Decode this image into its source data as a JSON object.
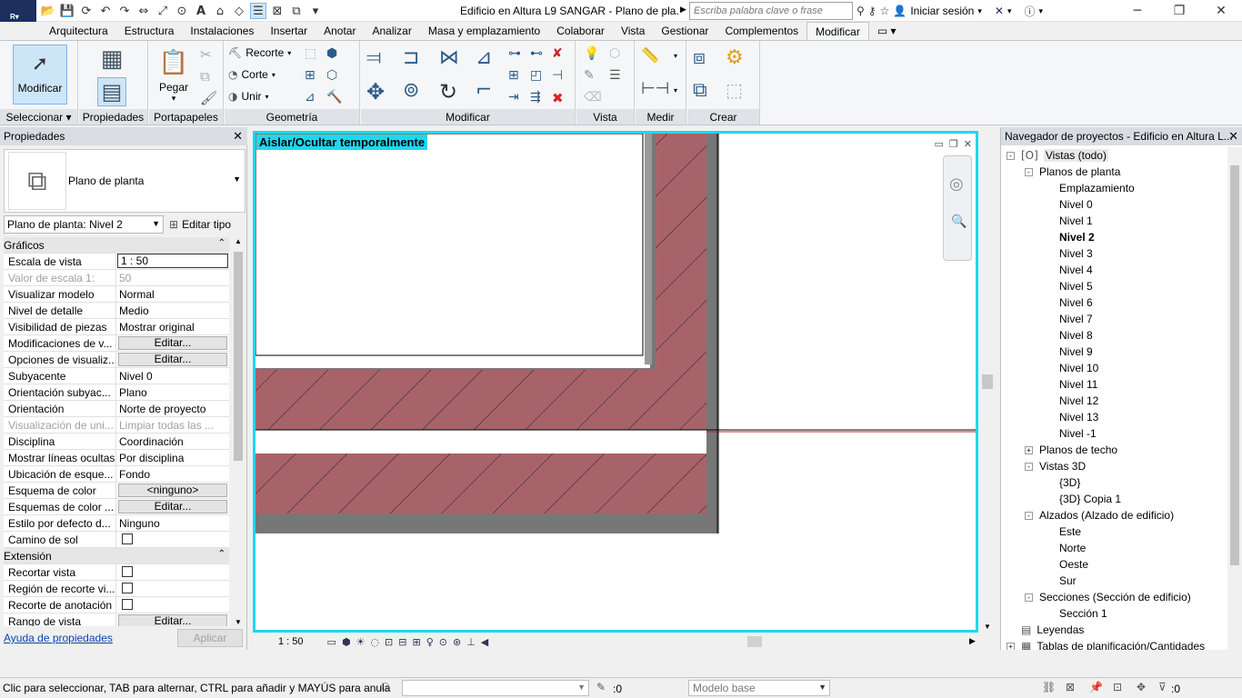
{
  "app": {
    "logo": "R",
    "window_title": "Edificio en Altura L9 SANGAR - Plano de pla...",
    "search_placeholder": "Escriba palabra clave o frase",
    "sign_in": "Iniciar sesión"
  },
  "tabs": [
    "Arquitectura",
    "Estructura",
    "Instalaciones",
    "Insertar",
    "Anotar",
    "Analizar",
    "Masa y emplazamiento",
    "Colaborar",
    "Vista",
    "Gestionar",
    "Complementos",
    "Modificar"
  ],
  "active_tab": "Modificar",
  "ribbon": {
    "panels": [
      "Seleccionar",
      "Propiedades",
      "Portapapeles",
      "Geometría",
      "Modificar",
      "Vista",
      "Medir",
      "Crear"
    ],
    "modify_btn": "Modificar",
    "paste_btn": "Pegar",
    "cut_btn": "Recorte",
    "trim_btn": "Corte",
    "join_btn": "Unir"
  },
  "properties": {
    "header": "Propiedades",
    "type_name": "Plano de planta",
    "instance": "Plano de planta: Nivel 2",
    "edit_type": "Editar tipo",
    "rows": [
      {
        "k": "Gráficos",
        "sec": true
      },
      {
        "k": "Escala de vista",
        "v": "1 : 50",
        "kind": "input"
      },
      {
        "k": "Valor de escala    1:",
        "v": "50",
        "dis": true
      },
      {
        "k": "Visualizar modelo",
        "v": "Normal"
      },
      {
        "k": "Nivel de detalle",
        "v": "Medio"
      },
      {
        "k": "Visibilidad de piezas",
        "v": "Mostrar original"
      },
      {
        "k": "Modificaciones de v...",
        "v": "Editar...",
        "kind": "btn"
      },
      {
        "k": "Opciones de visualiz...",
        "v": "Editar...",
        "kind": "btn"
      },
      {
        "k": "Subyacente",
        "v": "Nivel 0"
      },
      {
        "k": "Orientación subyac...",
        "v": "Plano"
      },
      {
        "k": "Orientación",
        "v": "Norte de proyecto"
      },
      {
        "k": "Visualización de uni...",
        "v": "Limpiar todas las ...",
        "dis": true
      },
      {
        "k": "Disciplina",
        "v": "Coordinación"
      },
      {
        "k": "Mostrar líneas ocultas",
        "v": "Por disciplina"
      },
      {
        "k": "Ubicación de esque...",
        "v": "Fondo"
      },
      {
        "k": "Esquema de color",
        "v": "<ninguno>",
        "kind": "btn"
      },
      {
        "k": "Esquemas de color ...",
        "v": "Editar...",
        "kind": "btn"
      },
      {
        "k": "Estilo por defecto d...",
        "v": "Ninguno"
      },
      {
        "k": "Camino de sol",
        "v": "",
        "kind": "cb"
      },
      {
        "k": "Extensión",
        "sec": true
      },
      {
        "k": "Recortar vista",
        "v": "",
        "kind": "cb"
      },
      {
        "k": "Región de recorte vi...",
        "v": "",
        "kind": "cb"
      },
      {
        "k": "Recorte de anotación",
        "v": "",
        "kind": "cb"
      },
      {
        "k": "Rango de vista",
        "v": "Editar...",
        "kind": "btn"
      }
    ],
    "help_link": "Ayuda de propiedades",
    "apply": "Aplicar"
  },
  "view": {
    "isolate_label": "Aislar/Ocultar temporalmente",
    "scale": "1 : 50",
    "wall_color": "#a8636a",
    "border_color": "#1fd7ef"
  },
  "browser": {
    "header": "Navegador de proyectos - Edificio en Altura L...",
    "nodes": [
      {
        "t": "Vistas (todo)",
        "lvl": 0,
        "tg": "-",
        "icon": "[O]",
        "sel": true
      },
      {
        "t": "Planos de planta",
        "lvl": 1,
        "tg": "-"
      },
      {
        "t": "Emplazamiento",
        "lvl": 2
      },
      {
        "t": "Nivel 0",
        "lvl": 2
      },
      {
        "t": "Nivel 1",
        "lvl": 2
      },
      {
        "t": "Nivel 2",
        "lvl": 2,
        "bold": true
      },
      {
        "t": "Nivel 3",
        "lvl": 2
      },
      {
        "t": "Nivel 4",
        "lvl": 2
      },
      {
        "t": "Nivel 5",
        "lvl": 2
      },
      {
        "t": "Nivel 6",
        "lvl": 2
      },
      {
        "t": "Nivel 7",
        "lvl": 2
      },
      {
        "t": "Nivel 8",
        "lvl": 2
      },
      {
        "t": "Nivel 9",
        "lvl": 2
      },
      {
        "t": "Nivel 10",
        "lvl": 2
      },
      {
        "t": "Nivel 11",
        "lvl": 2
      },
      {
        "t": "Nivel 12",
        "lvl": 2
      },
      {
        "t": "Nivel 13",
        "lvl": 2
      },
      {
        "t": "Nivel -1",
        "lvl": 2
      },
      {
        "t": "Planos de techo",
        "lvl": 1,
        "tg": "+"
      },
      {
        "t": "Vistas 3D",
        "lvl": 1,
        "tg": "-"
      },
      {
        "t": "{3D}",
        "lvl": 2
      },
      {
        "t": "{3D} Copia 1",
        "lvl": 2
      },
      {
        "t": "Alzados (Alzado de edificio)",
        "lvl": 1,
        "tg": "-"
      },
      {
        "t": "Este",
        "lvl": 2
      },
      {
        "t": "Norte",
        "lvl": 2
      },
      {
        "t": "Oeste",
        "lvl": 2
      },
      {
        "t": "Sur",
        "lvl": 2
      },
      {
        "t": "Secciones (Sección de edificio)",
        "lvl": 1,
        "tg": "-"
      },
      {
        "t": "Sección 1",
        "lvl": 2
      },
      {
        "t": "Leyendas",
        "lvl": 0,
        "icon": "▤"
      },
      {
        "t": "Tablas de planificación/Cantidades",
        "lvl": 0,
        "tg": "+",
        "icon": "▦"
      }
    ]
  },
  "status": {
    "hint": "Clic para seleccionar, TAB para alternar, CTRL para añadir y MAYÚS para anula",
    "workset_count": ":0",
    "model": "Modelo base",
    "filter_count": ":0"
  }
}
